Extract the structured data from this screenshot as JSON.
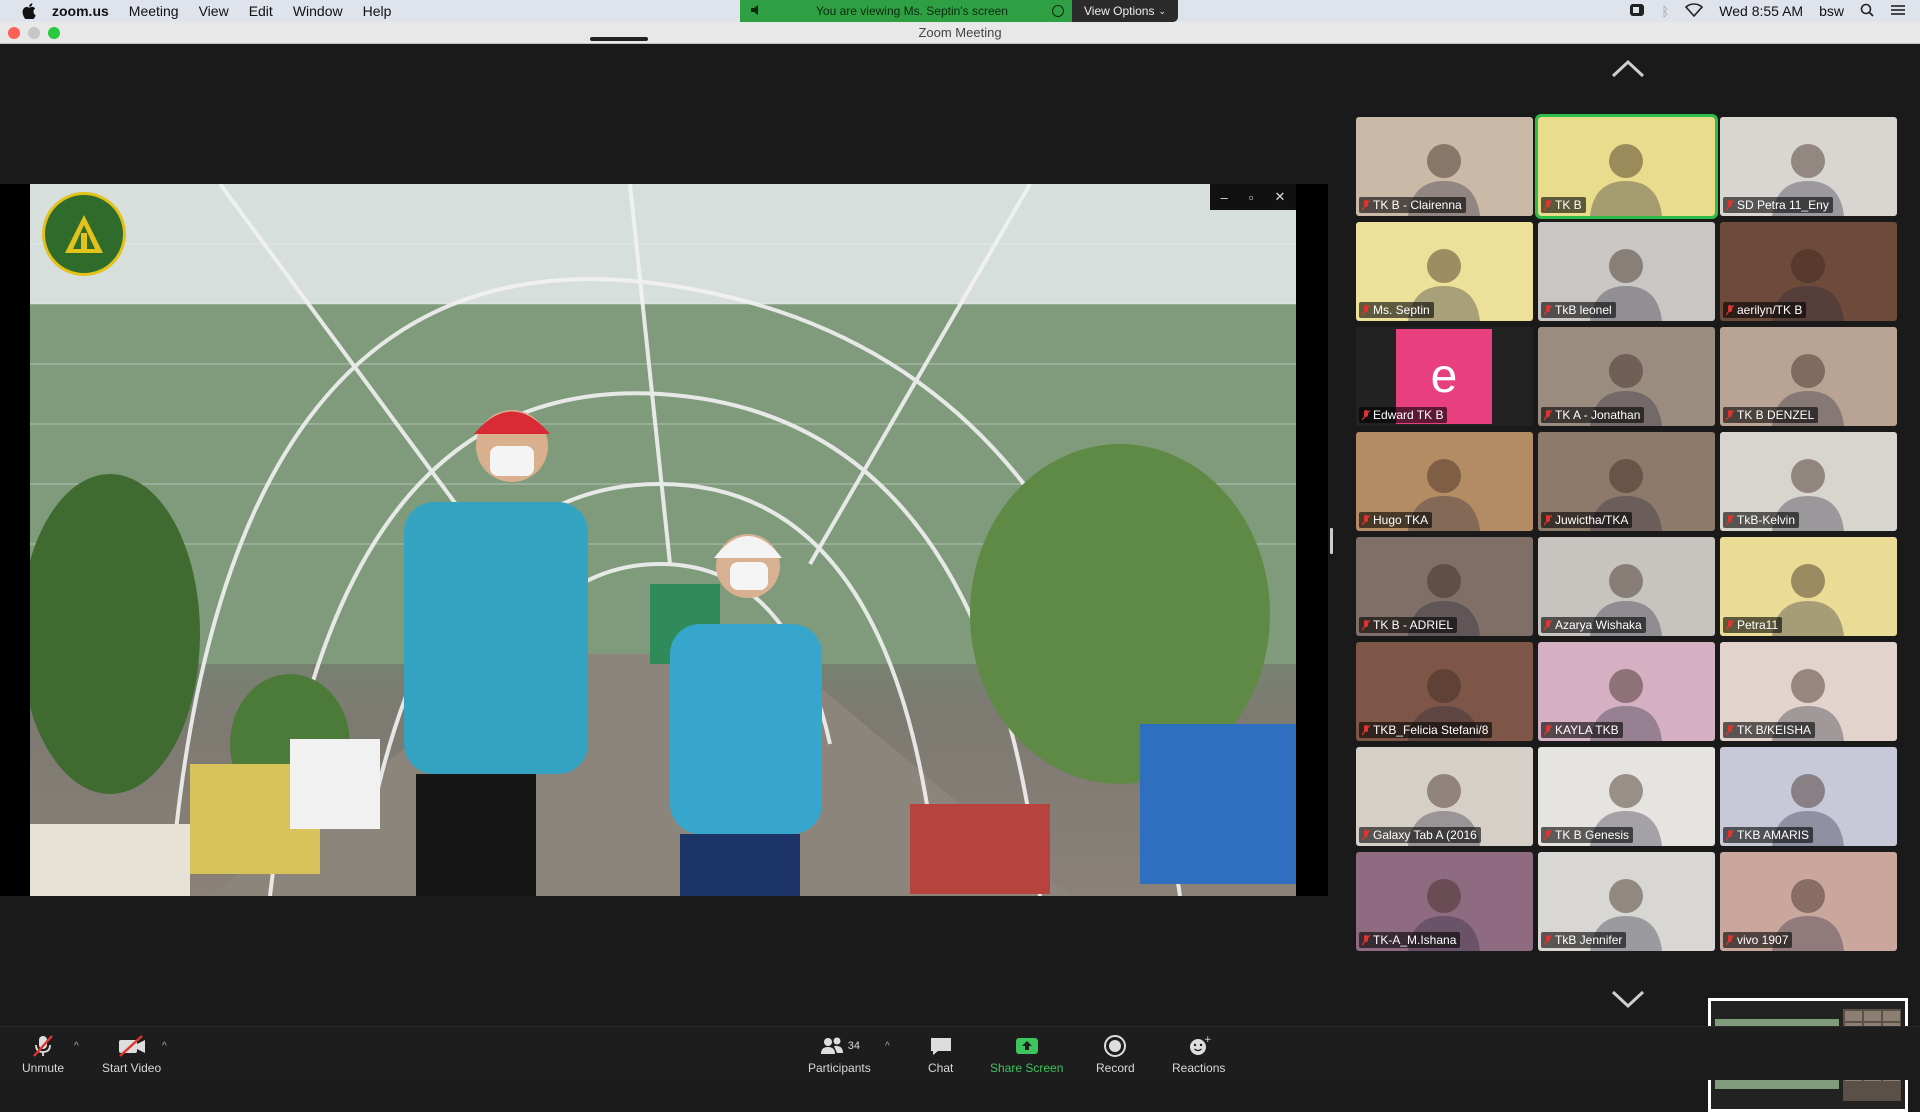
{
  "menubar": {
    "app_name": "zoom.us",
    "items": [
      "Meeting",
      "View",
      "Edit",
      "Window",
      "Help"
    ],
    "clock": "Wed 8:55 AM",
    "user": "bsw"
  },
  "share_banner": {
    "text": "You are viewing Ms. Septin's screen",
    "view_options": "View Options",
    "color": "#2ea043"
  },
  "window": {
    "title": "Zoom Meeting"
  },
  "participants_grid": [
    {
      "name": "TK B - Clairenna",
      "bg": "#c9b9a6"
    },
    {
      "name": "TK B",
      "bg": "#e9dc8c",
      "active": true
    },
    {
      "name": "SD Petra 11_Eny",
      "bg": "#d9d6d2"
    },
    {
      "name": "Ms. Septin",
      "bg": "#ede19a"
    },
    {
      "name": "TkB leonel",
      "bg": "#c9c6c4"
    },
    {
      "name": "aerilyn/TK B",
      "bg": "#6d4a3a"
    },
    {
      "name": "Edward TK B",
      "bg": "#222222",
      "avatar_letter": "e"
    },
    {
      "name": "TK A - Jonathan",
      "bg": "#9a8d80"
    },
    {
      "name": "TK B DENZEL",
      "bg": "#b8a394"
    },
    {
      "name": "Hugo TKA",
      "bg": "#b48c64"
    },
    {
      "name": "Juwictha/TKA",
      "bg": "#8e7a6a"
    },
    {
      "name": "TkB-Kelvin",
      "bg": "#d8d4ce"
    },
    {
      "name": "TK B - ADRIEL",
      "bg": "#7f6f66"
    },
    {
      "name": "Azarya Wishaka",
      "bg": "#c7c3bf"
    },
    {
      "name": "Petra11",
      "bg": "#eadb95"
    },
    {
      "name": "TKB_Felicia Stefani/8",
      "bg": "#7d5648"
    },
    {
      "name": "KAYLA TKB",
      "bg": "#d4b0c2"
    },
    {
      "name": "TK B/KEISHA",
      "bg": "#e2d4cc"
    },
    {
      "name": "Galaxy Tab A (2016",
      "bg": "#d6cfc8"
    },
    {
      "name": "TK B Genesis",
      "bg": "#e6e4e0"
    },
    {
      "name": "TKB AMARIS",
      "bg": "#c7c9d9"
    },
    {
      "name": "TK-A_M.Ishana",
      "bg": "#8e6b80"
    },
    {
      "name": "TkB Jennifer",
      "bg": "#d9d7d3"
    },
    {
      "name": "vivo 1907",
      "bg": "#c9a79d"
    }
  ],
  "toolbar": {
    "unmute": "Unmute",
    "start_video": "Start Video",
    "participants": "Participants",
    "participants_count": "34",
    "chat": "Chat",
    "share_screen": "Share Screen",
    "record": "Record",
    "reactions": "Reactions"
  }
}
